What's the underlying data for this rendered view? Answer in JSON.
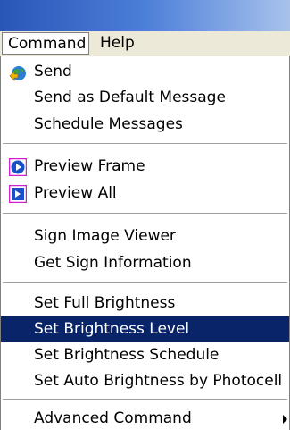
{
  "menubar": {
    "command_label": "Command",
    "help_label": "Help"
  },
  "menu": {
    "send": {
      "label": "Send",
      "icon": "globe-send-icon"
    },
    "send_default": {
      "label": "Send as Default Message"
    },
    "schedule_messages": {
      "label": "Schedule Messages"
    },
    "preview_frame": {
      "label": "Preview Frame",
      "icon": "preview-frame-icon"
    },
    "preview_all": {
      "label": "Preview All",
      "icon": "preview-all-icon"
    },
    "sign_image_viewer": {
      "label": "Sign Image Viewer"
    },
    "get_sign_info": {
      "label": "Get Sign Information"
    },
    "set_full_brightness": {
      "label": "Set Full Brightness"
    },
    "set_brightness_level": {
      "label": "Set Brightness Level",
      "highlighted": true
    },
    "set_brightness_schedule": {
      "label": "Set Brightness Schedule"
    },
    "set_auto_brightness": {
      "label": "Set Auto Brightness by Photocell"
    },
    "advanced_command": {
      "label": "Advanced Command",
      "submenu_icon": "chevron-right-icon"
    }
  },
  "colors": {
    "highlight": "#0a246a",
    "titlebar": "#2856b8",
    "menu_bg": "#ffffff"
  }
}
